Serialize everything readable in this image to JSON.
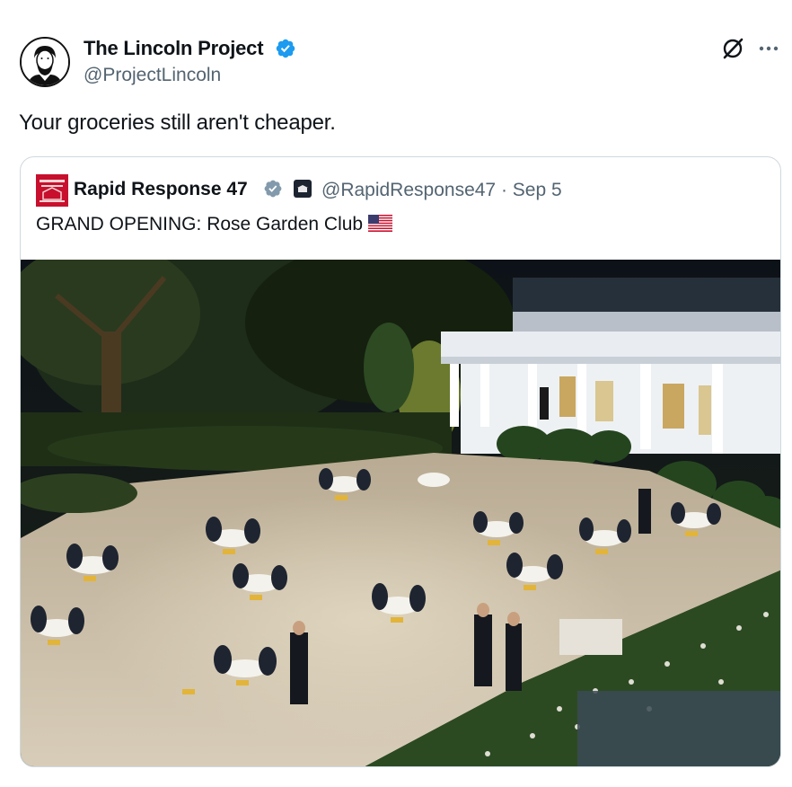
{
  "author": {
    "name": "The Lincoln Project",
    "handle": "@ProjectLincoln",
    "verified": true,
    "avatar_icon": "lincoln-portrait-avatar"
  },
  "tweet": {
    "text": "Your groceries still aren't cheaper."
  },
  "quote": {
    "name": "Rapid Response 47",
    "handle_line": "@RapidResponse47 · Sep 5",
    "text": "GRAND OPENING: Rose Garden Club",
    "flag_icon": "us-flag-emoji",
    "avatar_icon": "rapid-response-logo",
    "affiliation_icon": "white-house-badge"
  },
  "colors": {
    "verified_blue": "#1d9bf0",
    "verified_gray": "#829aab",
    "secondary_text": "#536471",
    "border": "#cfd9de"
  }
}
